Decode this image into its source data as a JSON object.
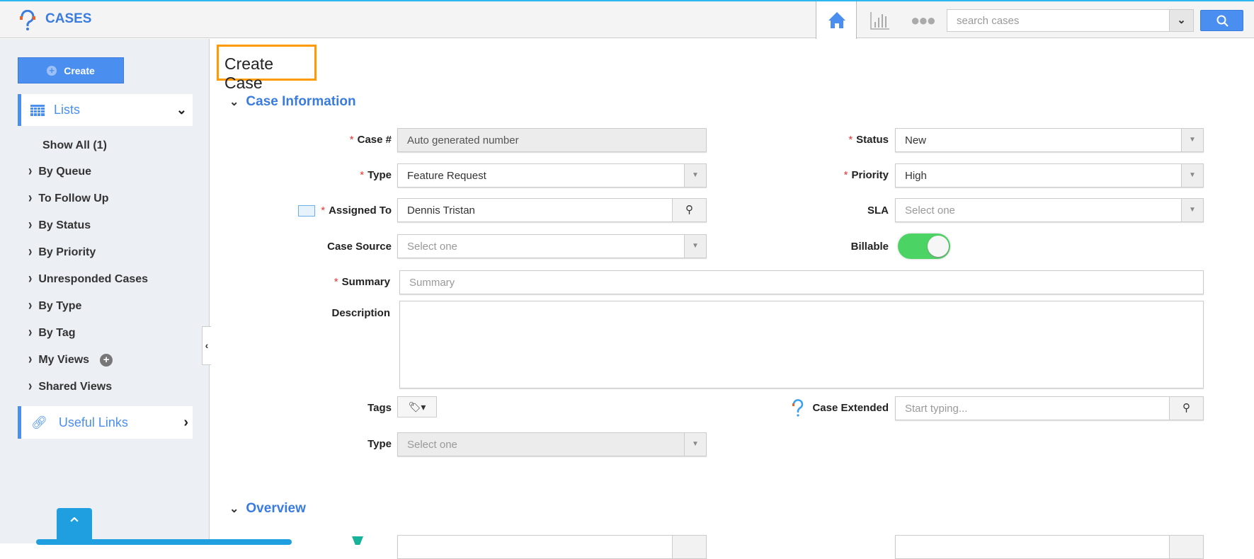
{
  "app": {
    "title": "CASES"
  },
  "header": {
    "search_placeholder": "search cases"
  },
  "sidebar": {
    "create_label": "Create",
    "lists_label": "Lists",
    "items": [
      {
        "label": "Show All (1)"
      },
      {
        "label": "By Queue"
      },
      {
        "label": "To Follow Up"
      },
      {
        "label": "By Status"
      },
      {
        "label": "By Priority"
      },
      {
        "label": "Unresponded Cases"
      },
      {
        "label": "By Type"
      },
      {
        "label": "By Tag"
      },
      {
        "label": "My Views"
      },
      {
        "label": "Shared Views"
      }
    ],
    "useful_links_label": "Useful Links"
  },
  "page": {
    "title": "Create Case"
  },
  "case_info": {
    "heading": "Case Information",
    "case_no": {
      "label": "Case #",
      "value": "Auto generated number"
    },
    "type": {
      "label": "Type",
      "value": "Feature Request"
    },
    "assigned_to": {
      "label": "Assigned To",
      "value": "Dennis Tristan"
    },
    "case_source": {
      "label": "Case Source",
      "placeholder": "Select one"
    },
    "status": {
      "label": "Status",
      "value": "New"
    },
    "priority": {
      "label": "Priority",
      "value": "High"
    },
    "sla": {
      "label": "SLA",
      "placeholder": "Select one"
    },
    "billable": {
      "label": "Billable",
      "on": true
    },
    "summary": {
      "label": "Summary",
      "placeholder": "Summary"
    },
    "description": {
      "label": "Description"
    },
    "tags": {
      "label": "Tags"
    },
    "case_extended": {
      "label": "Case Extended",
      "placeholder": "Start typing..."
    },
    "type2": {
      "label": "Type",
      "placeholder": "Select one"
    }
  },
  "overview": {
    "heading": "Overview"
  },
  "colors": {
    "accent": "#4a8ff0",
    "highlight": "#ff9a00",
    "toggle": "#4bd464"
  }
}
